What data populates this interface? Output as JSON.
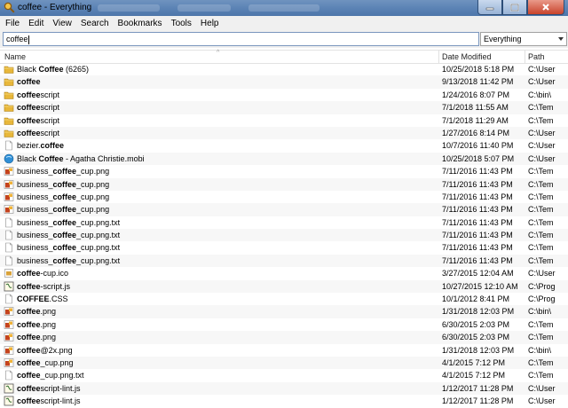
{
  "window": {
    "title": "coffee - Everything",
    "icon": "magnifier-app-icon",
    "controls": [
      "minimize",
      "maximize",
      "close"
    ]
  },
  "menu": [
    "File",
    "Edit",
    "View",
    "Search",
    "Bookmarks",
    "Tools",
    "Help"
  ],
  "search": {
    "value": "coffee"
  },
  "filter": {
    "selected": "Everything"
  },
  "columns": {
    "name": "Name",
    "date": "Date Modified",
    "path": "Path"
  },
  "results": [
    {
      "icon": "folder",
      "pre": "Black ",
      "hl": "Coffee",
      "post": " (6265)",
      "date": "10/25/2018 5:18 PM",
      "path": "C:\\User"
    },
    {
      "icon": "folder",
      "pre": "",
      "hl": "coffee",
      "post": "",
      "date": "9/13/2018 11:42 PM",
      "path": "C:\\User"
    },
    {
      "icon": "folder",
      "pre": "",
      "hl": "coffee",
      "post": "script",
      "date": "1/24/2016 8:07 PM",
      "path": "C:\\bin\\"
    },
    {
      "icon": "folder",
      "pre": "",
      "hl": "coffee",
      "post": "script",
      "date": "7/1/2018 11:55 AM",
      "path": "C:\\Tem"
    },
    {
      "icon": "folder",
      "pre": "",
      "hl": "coffee",
      "post": "script",
      "date": "7/1/2018 11:29 AM",
      "path": "C:\\Tem"
    },
    {
      "icon": "folder",
      "pre": "",
      "hl": "coffee",
      "post": "script",
      "date": "1/27/2016 8:14 PM",
      "path": "C:\\User"
    },
    {
      "icon": "file",
      "pre": "bezier.",
      "hl": "coffee",
      "post": "",
      "date": "10/7/2016 11:40 PM",
      "path": "C:\\User"
    },
    {
      "icon": "mobi",
      "pre": "Black ",
      "hl": "Coffee",
      "post": " - Agatha Christie.mobi",
      "date": "10/25/2018 5:07 PM",
      "path": "C:\\User"
    },
    {
      "icon": "png",
      "pre": "business_",
      "hl": "coffee",
      "post": "_cup.png",
      "date": "7/11/2016 11:43 PM",
      "path": "C:\\Tem"
    },
    {
      "icon": "png",
      "pre": "business_",
      "hl": "coffee",
      "post": "_cup.png",
      "date": "7/11/2016 11:43 PM",
      "path": "C:\\Tem"
    },
    {
      "icon": "png",
      "pre": "business_",
      "hl": "coffee",
      "post": "_cup.png",
      "date": "7/11/2016 11:43 PM",
      "path": "C:\\Tem"
    },
    {
      "icon": "png",
      "pre": "business_",
      "hl": "coffee",
      "post": "_cup.png",
      "date": "7/11/2016 11:43 PM",
      "path": "C:\\Tem"
    },
    {
      "icon": "file",
      "pre": "business_",
      "hl": "coffee",
      "post": "_cup.png.txt",
      "date": "7/11/2016 11:43 PM",
      "path": "C:\\Tem"
    },
    {
      "icon": "file",
      "pre": "business_",
      "hl": "coffee",
      "post": "_cup.png.txt",
      "date": "7/11/2016 11:43 PM",
      "path": "C:\\Tem"
    },
    {
      "icon": "file",
      "pre": "business_",
      "hl": "coffee",
      "post": "_cup.png.txt",
      "date": "7/11/2016 11:43 PM",
      "path": "C:\\Tem"
    },
    {
      "icon": "file",
      "pre": "business_",
      "hl": "coffee",
      "post": "_cup.png.txt",
      "date": "7/11/2016 11:43 PM",
      "path": "C:\\Tem"
    },
    {
      "icon": "ico",
      "pre": "",
      "hl": "coffee",
      "post": "-cup.ico",
      "date": "3/27/2015 12:04 AM",
      "path": "C:\\User"
    },
    {
      "icon": "script",
      "pre": "",
      "hl": "coffee",
      "post": "-script.js",
      "date": "10/27/2015 12:10 AM",
      "path": "C:\\Prog"
    },
    {
      "icon": "file",
      "pre": "",
      "hl": "COFFEE",
      "post": ".CSS",
      "date": "10/1/2012 8:41 PM",
      "path": "C:\\Prog"
    },
    {
      "icon": "png",
      "pre": "",
      "hl": "coffee",
      "post": ".png",
      "date": "1/31/2018 12:03 PM",
      "path": "C:\\bin\\"
    },
    {
      "icon": "png",
      "pre": "",
      "hl": "coffee",
      "post": ".png",
      "date": "6/30/2015 2:03 PM",
      "path": "C:\\Tem"
    },
    {
      "icon": "png",
      "pre": "",
      "hl": "coffee",
      "post": ".png",
      "date": "6/30/2015 2:03 PM",
      "path": "C:\\Tem"
    },
    {
      "icon": "png",
      "pre": "",
      "hl": "coffee",
      "post": "@2x.png",
      "date": "1/31/2018 12:03 PM",
      "path": "C:\\bin\\"
    },
    {
      "icon": "png",
      "pre": "",
      "hl": "coffee",
      "post": "_cup.png",
      "date": "4/1/2015 7:12 PM",
      "path": "C:\\Tem"
    },
    {
      "icon": "file",
      "pre": "",
      "hl": "coffee",
      "post": "_cup.png.txt",
      "date": "4/1/2015 7:12 PM",
      "path": "C:\\Tem"
    },
    {
      "icon": "script",
      "pre": "",
      "hl": "coffee",
      "post": "script-lint.js",
      "date": "1/12/2017 11:28 PM",
      "path": "C:\\User"
    },
    {
      "icon": "script",
      "pre": "",
      "hl": "coffee",
      "post": "script-lint.js",
      "date": "1/12/2017 11:28 PM",
      "path": "C:\\User"
    }
  ],
  "colors": {
    "titlebar": "#5a82b4",
    "folder": "#e8b73a",
    "selection_border": "#7a96bd",
    "close_button": "#c8432b"
  }
}
